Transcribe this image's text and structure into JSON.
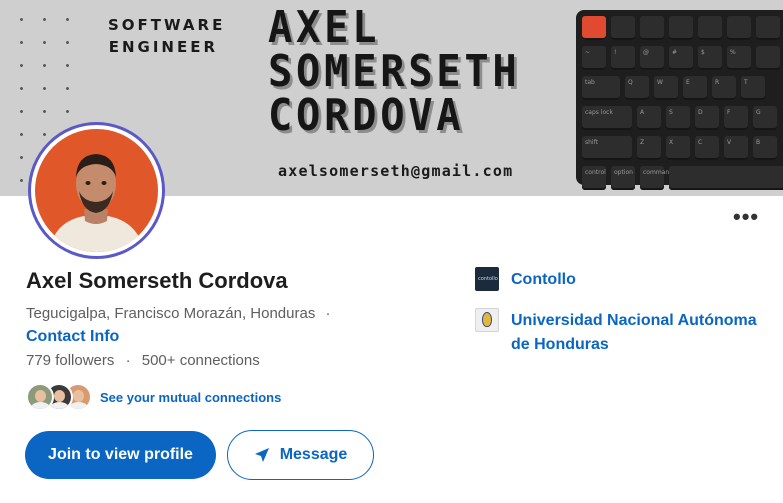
{
  "banner": {
    "role_line1": "SOFTWARE",
    "role_line2": "ENGINEER",
    "name_line1": "AXEL",
    "name_line2": "SOMERSETH",
    "name_line3": "CORDOVA",
    "email": "axelsomerseth@gmail.com",
    "keyboard_labels": {
      "row2": [
        "~",
        "!",
        "@",
        "#",
        "$",
        "%"
      ],
      "tab": "tab",
      "row3": [
        "Q",
        "W",
        "E",
        "R",
        "T"
      ],
      "caps": "caps lock",
      "row4": [
        "A",
        "S",
        "D",
        "F",
        "G"
      ],
      "shift": "shift",
      "row5": [
        "Z",
        "X",
        "C",
        "V",
        "B"
      ],
      "control": "control",
      "option": "option",
      "command": "command"
    }
  },
  "profile": {
    "name": "Axel Somerseth Cordova",
    "location": "Tegucigalpa, Francisco Morazán, Honduras",
    "location_sep": "·",
    "contact_info": "Contact Info",
    "followers": "779 followers",
    "stats_sep": "·",
    "connections": "500+ connections",
    "mutual_text": "See your mutual connections"
  },
  "actions": {
    "more": "•••",
    "join_label": "Join to view profile",
    "message_label": "Message"
  },
  "organizations": [
    {
      "name": "Contollo",
      "logo_text": "contollo"
    },
    {
      "name": "Universidad Nacional Autónoma de Honduras"
    }
  ],
  "colors": {
    "primary_blue": "#0a66c2",
    "banner_gray": "#cfcfcf",
    "avatar_bg": "#e0572a",
    "esc_key": "#e04a30"
  },
  "icons": {
    "more": "more-horizontal-icon",
    "message": "paper-plane-icon"
  }
}
